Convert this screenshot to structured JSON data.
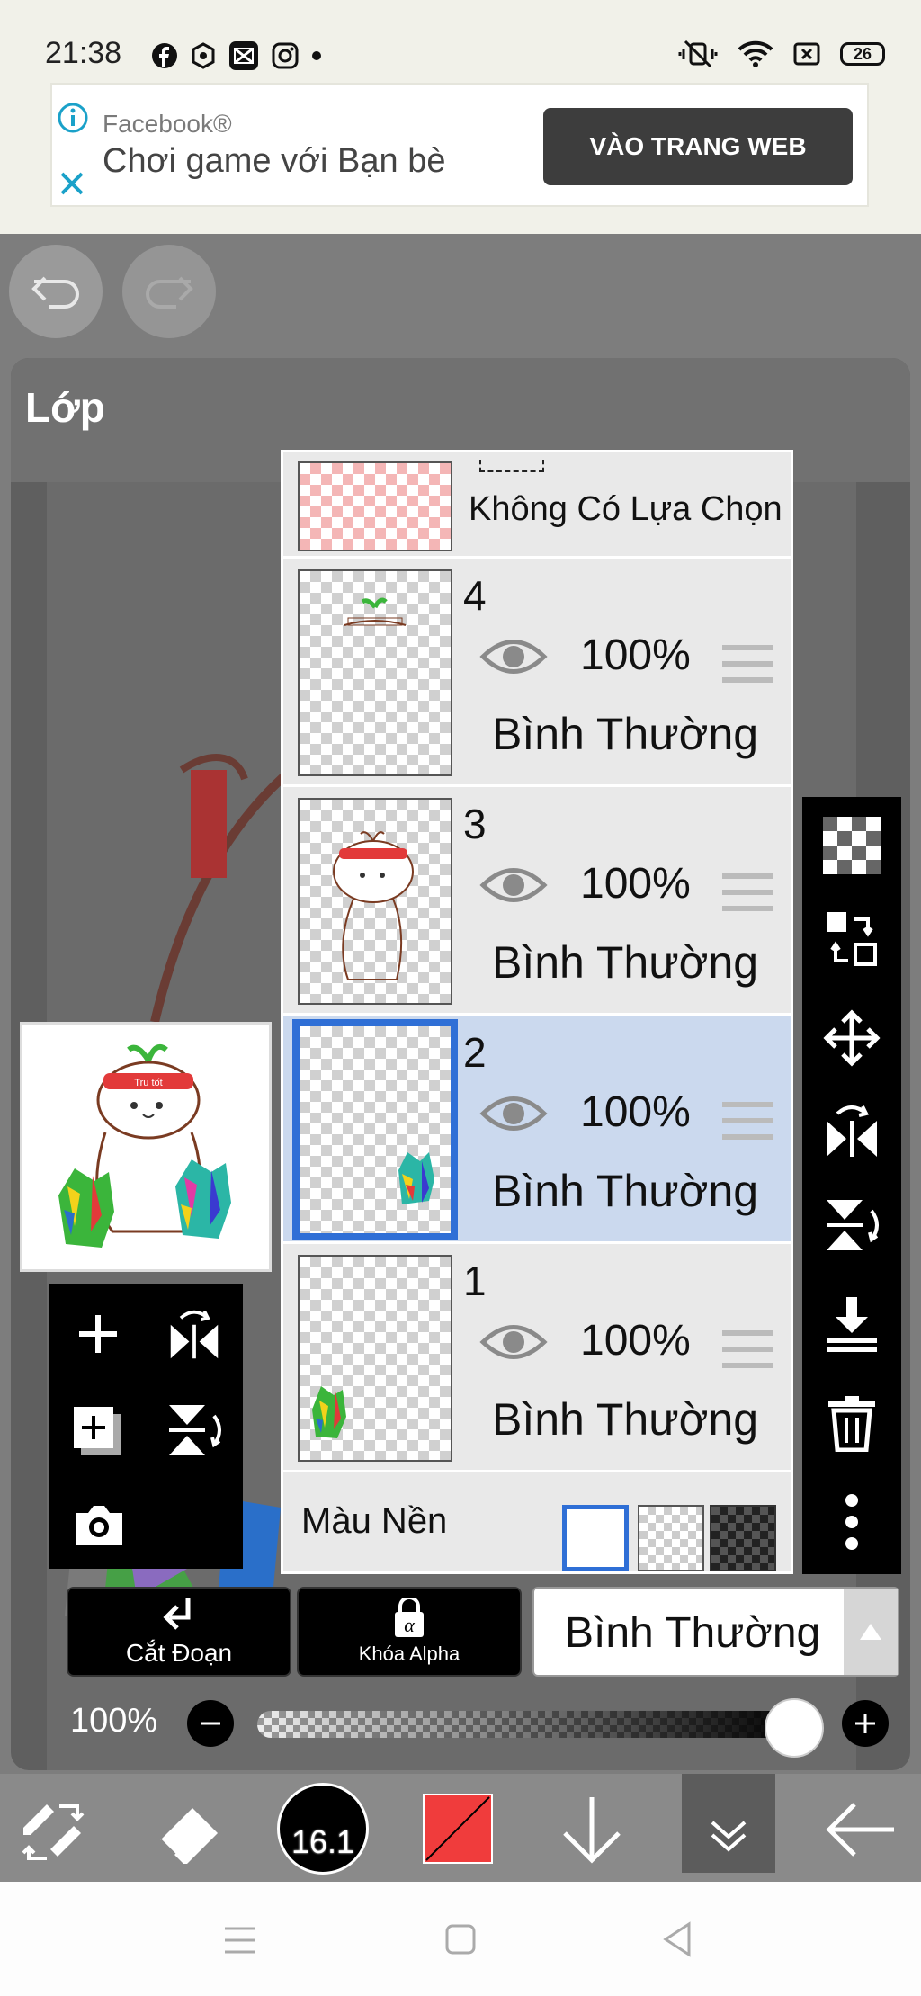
{
  "status_bar": {
    "time": "21:38",
    "battery": "26",
    "notification_icons": [
      "facebook-icon",
      "hexagon-icon",
      "capcut-icon",
      "instagram-icon",
      "dot-icon"
    ]
  },
  "ad": {
    "source": "Facebook®",
    "title": "Chơi game với Bạn bè",
    "button": "VÀO TRANG WEB"
  },
  "panel": {
    "title": "Lớp"
  },
  "selection_row": {
    "label": "Không Có Lựa Chọn"
  },
  "layers": [
    {
      "number": "4",
      "opacity": "100%",
      "blend": "Bình Thường",
      "selected": false
    },
    {
      "number": "3",
      "opacity": "100%",
      "blend": "Bình Thường",
      "selected": false
    },
    {
      "number": "2",
      "opacity": "100%",
      "blend": "Bình Thường",
      "selected": true
    },
    {
      "number": "1",
      "opacity": "100%",
      "blend": "Bình Thường",
      "selected": false
    }
  ],
  "background": {
    "label": "Màu Nền",
    "options": [
      "white",
      "transparent",
      "dark-checker"
    ],
    "selected": "white"
  },
  "preview_text": "Tru tốt",
  "buttons": {
    "clipping": "Cắt Đoạn",
    "alpha_lock": "Khóa Alpha"
  },
  "blend_mode": {
    "value": "Bình Thường"
  },
  "opacity": {
    "label": "100%",
    "value": 1.0
  },
  "brush": {
    "size": "16.1",
    "color": "#f03c3c"
  },
  "colors": {
    "accent": "#2f6fd6",
    "selected_row": "#cbd9ee",
    "ad_button": "#3d3d3d"
  }
}
